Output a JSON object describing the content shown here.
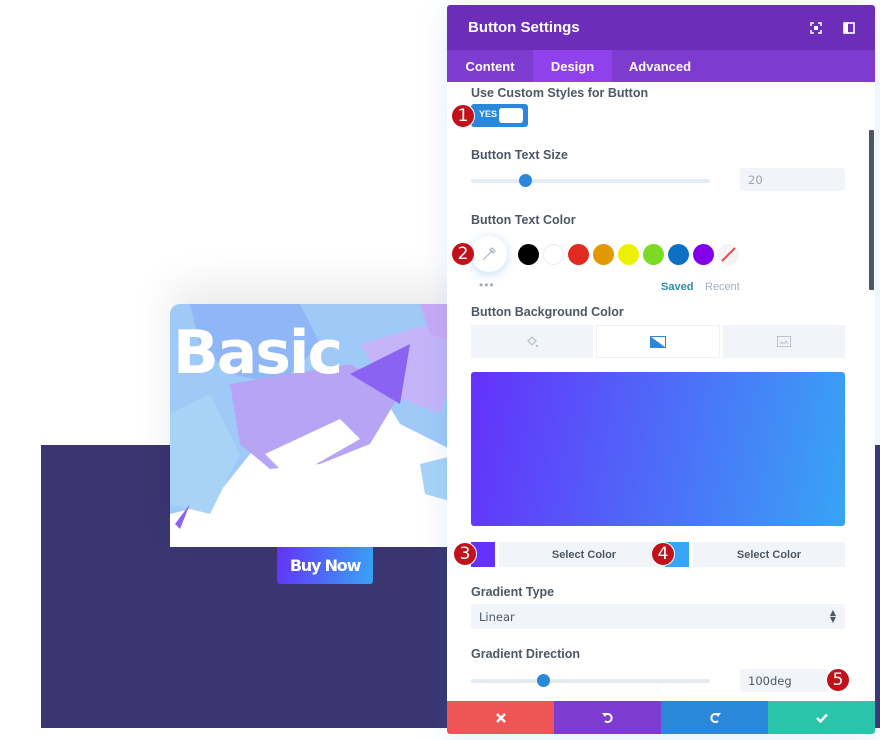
{
  "preview": {
    "card_title": "Basic",
    "button_label": "Buy Now",
    "section_color": "#3b3571"
  },
  "panel": {
    "title": "Button Settings",
    "header_icons": [
      "expand-icon",
      "split-view-icon"
    ],
    "tabs": [
      {
        "label": "Content",
        "active": false
      },
      {
        "label": "Design",
        "active": true
      },
      {
        "label": "Advanced",
        "active": false
      }
    ],
    "custom_styles": {
      "label": "Use Custom Styles for Button",
      "toggle_value": "YES"
    },
    "text_size": {
      "label": "Button Text Size",
      "value": "20",
      "slider_fraction": 0.2
    },
    "text_color": {
      "label": "Button Text Color",
      "swatches": [
        "#000000",
        "#ffffff",
        "#e02b20",
        "#e09900",
        "#edf000",
        "#7cda24",
        "#0c71c3",
        "#8300e9"
      ],
      "more_label": "•••",
      "saved_label": "Saved",
      "recent_label": "Recent"
    },
    "background_color": {
      "label": "Button Background Color",
      "tabs": [
        "color-fill-icon",
        "gradient-icon",
        "image-icon"
      ],
      "active_tab": "gradient-icon",
      "gradient_start": "#6431fb",
      "gradient_end": "#38a4f5",
      "stop1_label": "Select Color",
      "stop2_label": "Select Color"
    },
    "gradient_type": {
      "label": "Gradient Type",
      "value": "Linear"
    },
    "gradient_direction": {
      "label": "Gradient Direction",
      "value": "100deg",
      "slider_fraction": 0.278
    },
    "footer": {
      "cancel_color": "#ef5555",
      "undo_color": "#7e3bd0",
      "redo_color": "#2b87da",
      "save_color": "#29c4a9"
    }
  },
  "badges": [
    "1",
    "2",
    "3",
    "4",
    "5"
  ]
}
